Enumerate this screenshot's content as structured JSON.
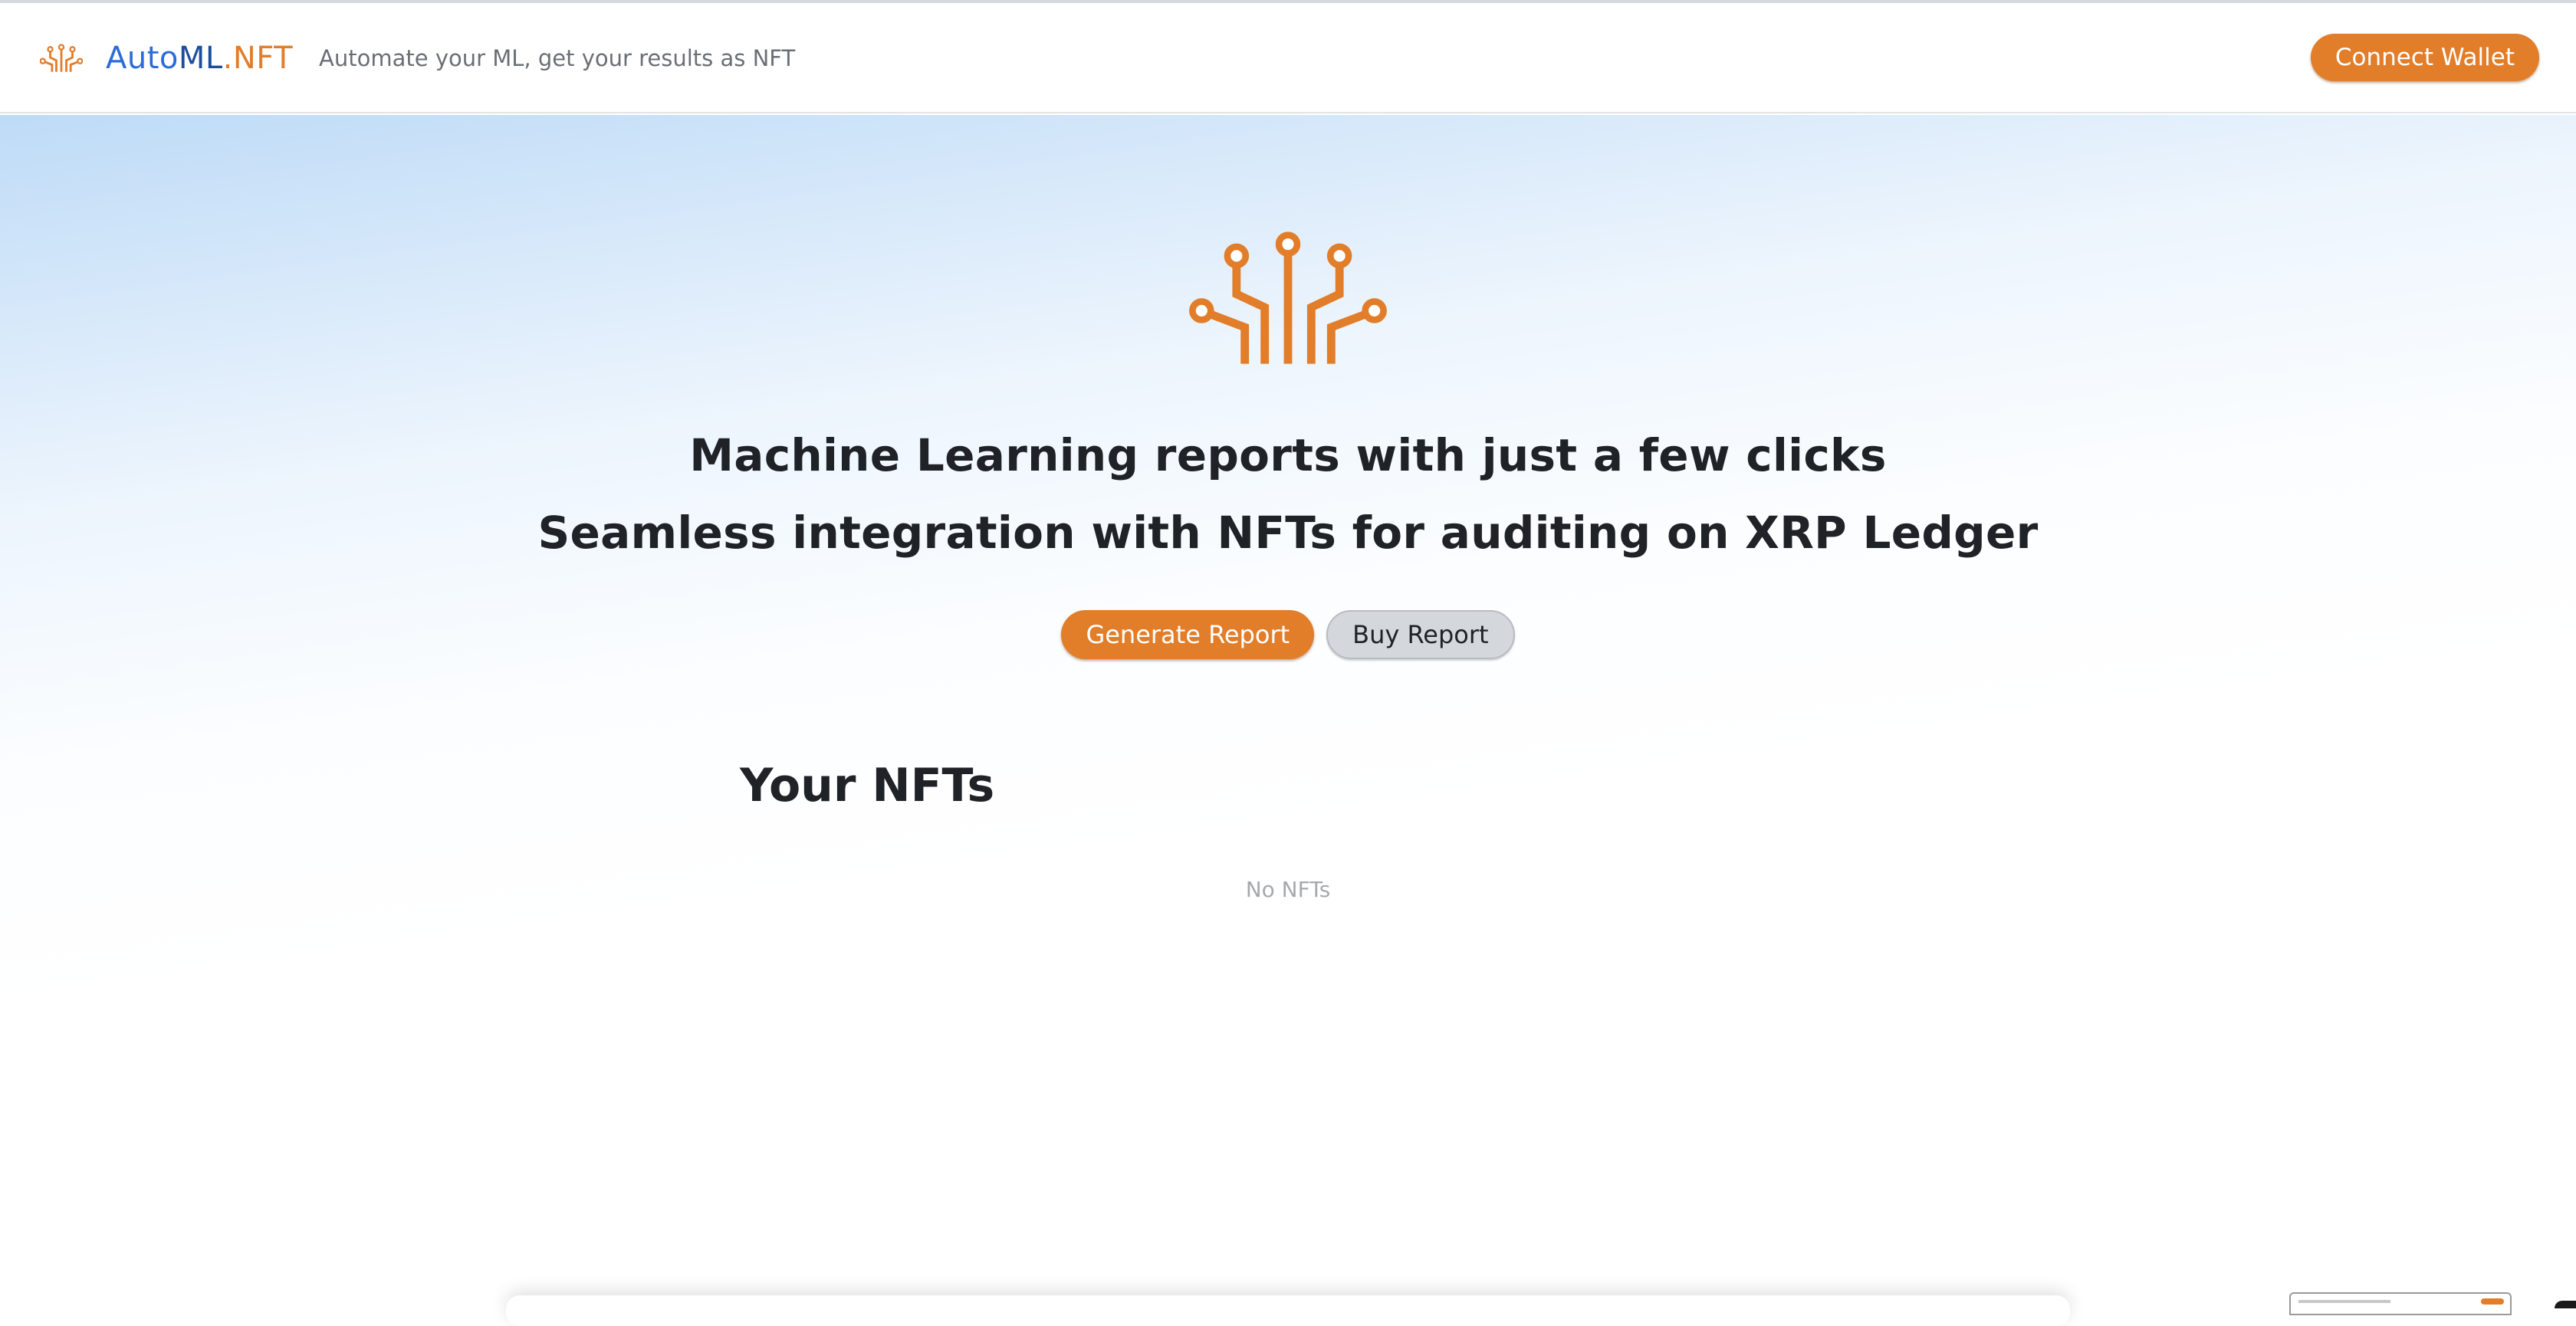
{
  "brand": {
    "logo_icon": "circuit-tree-icon",
    "name_part_1": "Auto",
    "name_part_2": "ML",
    "name_part_3": ".NFT",
    "tagline": "Automate your ML, get your results as NFT"
  },
  "header": {
    "connect_label": "Connect Wallet"
  },
  "hero": {
    "icon": "circuit-tree-icon",
    "headline_1": "Machine Learning reports with just a few clicks",
    "headline_2": "Seamless integration with NFTs for auditing on XRP Ledger",
    "generate_label": "Generate Report",
    "buy_label": "Buy Report"
  },
  "nfts": {
    "title": "Your NFTs",
    "empty": "No NFTs"
  },
  "colors": {
    "accent": "#e27d2a",
    "brand_blue": "#2b6cd8",
    "brand_navy": "#1a4e9c",
    "secondary_button": "#d4d7dc",
    "muted_text": "#a6a9ad"
  }
}
